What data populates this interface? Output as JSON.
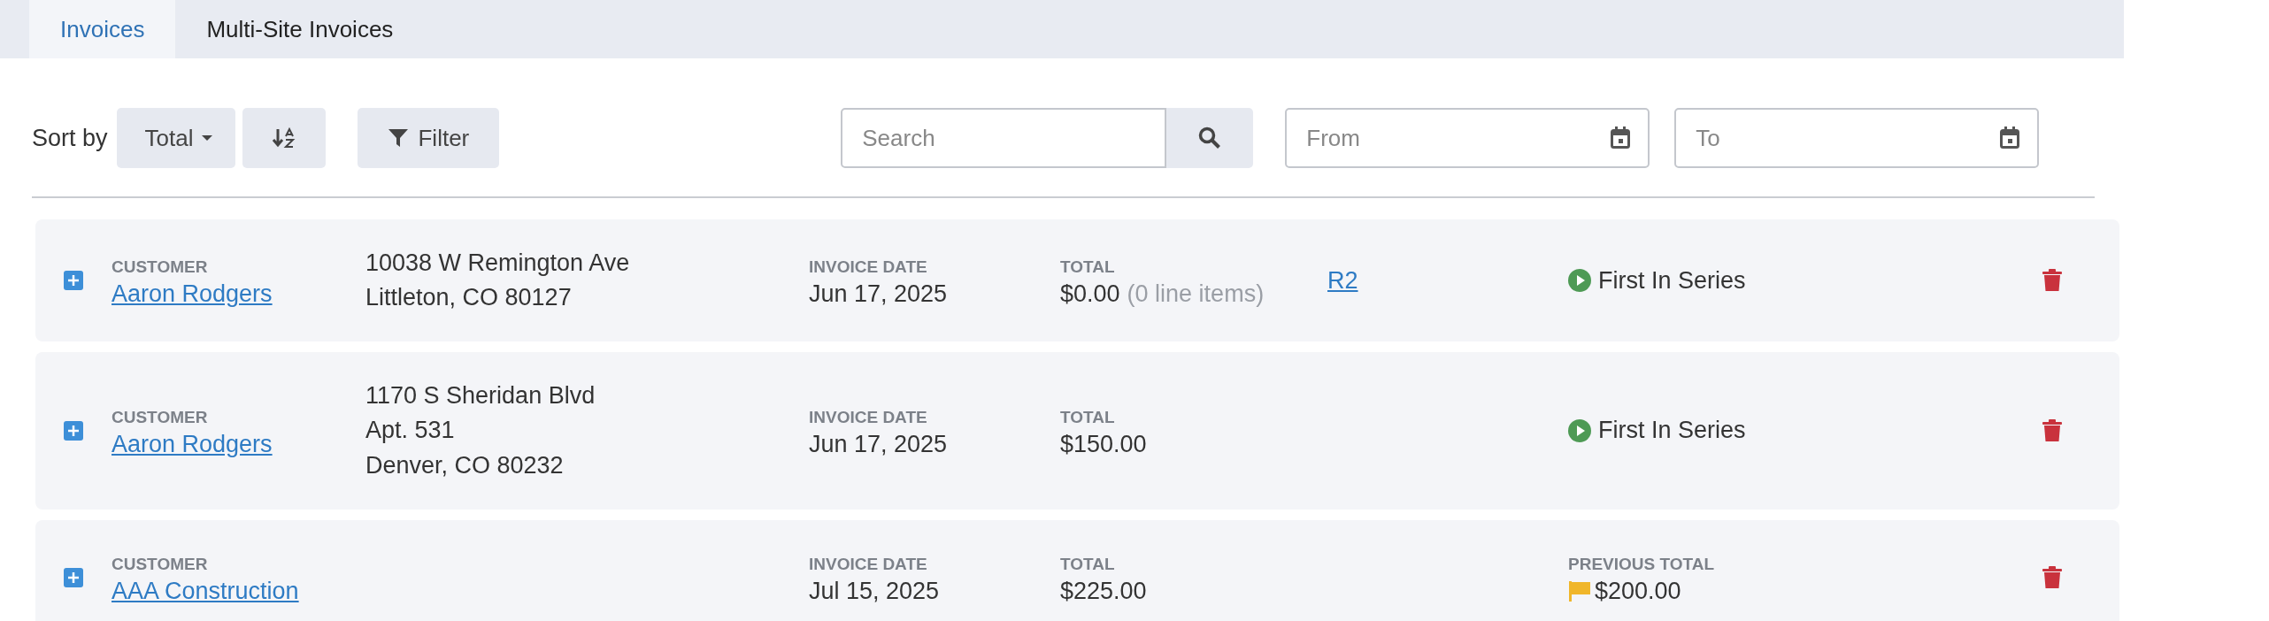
{
  "tabs": [
    {
      "label": "Invoices",
      "selected": true
    },
    {
      "label": "Multi-Site Invoices",
      "selected": false
    }
  ],
  "toolbar": {
    "sort_label": "Sort by",
    "sort_field": "Total",
    "filter_button": "Filter",
    "search": {
      "placeholder": "Search"
    },
    "from_date": {
      "placeholder": "From"
    },
    "to_date": {
      "placeholder": "To"
    }
  },
  "invoices": [
    {
      "customer_label": "CUSTOMER",
      "customer": "Aaron Rodgers",
      "address": [
        "10038 W Remington Ave",
        "Littleton, CO 80127"
      ],
      "date_label": "INVOICE DATE",
      "date": "Jun 17, 2025",
      "total_label": "TOTAL",
      "total": "$0.00",
      "line_items": "(0 line items)",
      "reference": "R2",
      "status": {
        "kind": "series",
        "text": "First In Series"
      }
    },
    {
      "customer_label": "CUSTOMER",
      "customer": "Aaron Rodgers",
      "address": [
        "1170 S Sheridan Blvd",
        "Apt. 531",
        "Denver, CO 80232"
      ],
      "date_label": "INVOICE DATE",
      "date": "Jun 17, 2025",
      "total_label": "TOTAL",
      "total": "$150.00",
      "status": {
        "kind": "series",
        "text": "First In Series"
      }
    },
    {
      "customer_label": "CUSTOMER",
      "customer": "AAA Construction",
      "date_label": "INVOICE DATE",
      "date": "Jul 15, 2025",
      "total_label": "TOTAL",
      "total": "$225.00",
      "status": {
        "kind": "previous_total",
        "label": "PREVIOUS TOTAL",
        "text": "$200.00"
      }
    }
  ]
}
